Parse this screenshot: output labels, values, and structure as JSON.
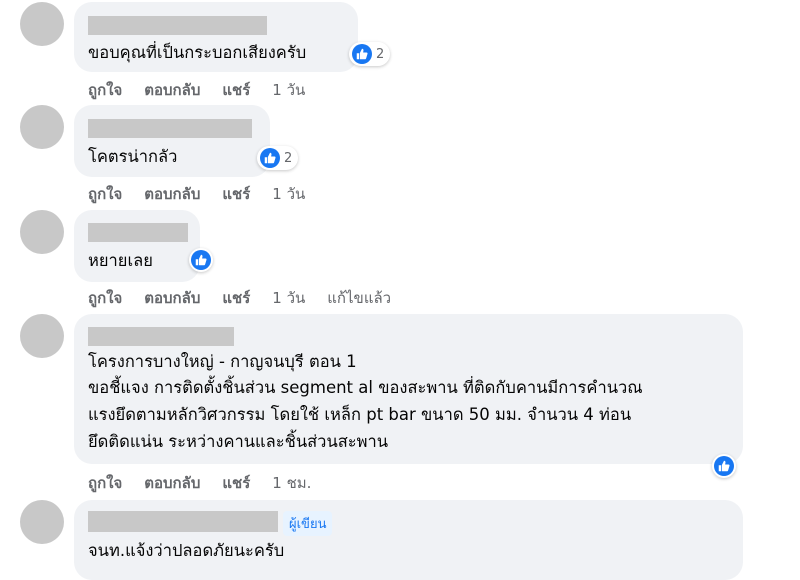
{
  "comments": [
    {
      "text": "ขอบคุณที่เป็นกระบอกเสียงครับ",
      "reaction_count": "2",
      "actions": {
        "like": "ถูกใจ",
        "reply": "ตอบกลับ",
        "share": "แชร์",
        "time": "1 วัน"
      }
    },
    {
      "text": "โคตรน่ากลัว",
      "reaction_count": "2",
      "actions": {
        "like": "ถูกใจ",
        "reply": "ตอบกลับ",
        "share": "แชร์",
        "time": "1 วัน"
      }
    },
    {
      "text": "หยายเลย",
      "reaction_count": "",
      "actions": {
        "like": "ถูกใจ",
        "reply": "ตอบกลับ",
        "share": "แชร์",
        "time": "1 วัน",
        "edited": "แก้ไขแล้ว"
      }
    },
    {
      "lines": [
        "โครงการบางใหญ่ - กาญจนบุรี ตอน 1",
        "ขอชี้แจง การติดตั้งชิ้นส่วน segment al ของสะพาน ที่ติดกับคานมีการคำนวณ",
        "แรงยึดตามหลักวิศวกรรม โดยใช้ เหล็ก pt bar ขนาด 50 มม. จำนวน 4 ท่อน",
        "ยึดติดแน่น ระหว่างคานและชิ้นส่วนสะพาน"
      ],
      "actions": {
        "like": "ถูกใจ",
        "reply": "ตอบกลับ",
        "share": "แชร์",
        "time": "1 ชม."
      }
    },
    {
      "author_badge": "ผู้เขียน",
      "text": "จนท.แจ้งว่าปลอดภัยนะครับ"
    }
  ],
  "colors": {
    "like_blue": "#1877f2",
    "bubble_bg": "#f0f2f5",
    "meta_gray": "#65676b"
  },
  "icons": {
    "reaction": "thumbs-up-icon"
  }
}
